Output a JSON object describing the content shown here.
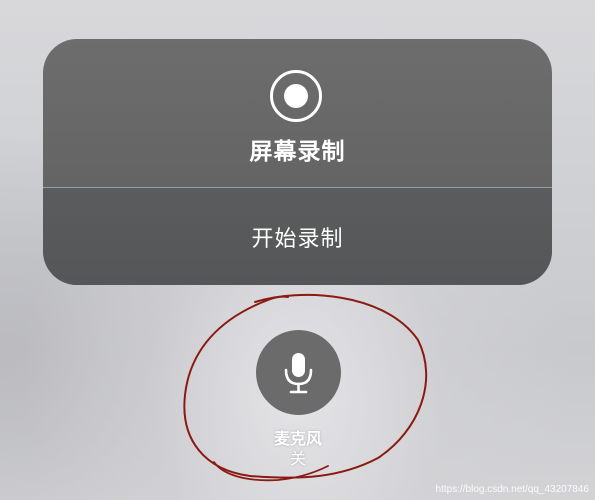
{
  "record_panel": {
    "icon": "screen-record-icon",
    "title": "屏幕录制",
    "start_label": "开始录制"
  },
  "microphone": {
    "icon": "microphone-icon",
    "label": "麦克风",
    "status": "关"
  },
  "watermark": "https://blog.csdn.net/qq_43207846",
  "colors": {
    "panel": "#676767",
    "start_row": "#58595a",
    "mic_button": "#6b6b6c",
    "annotation": "#8b1a12",
    "text": "#ffffff"
  }
}
